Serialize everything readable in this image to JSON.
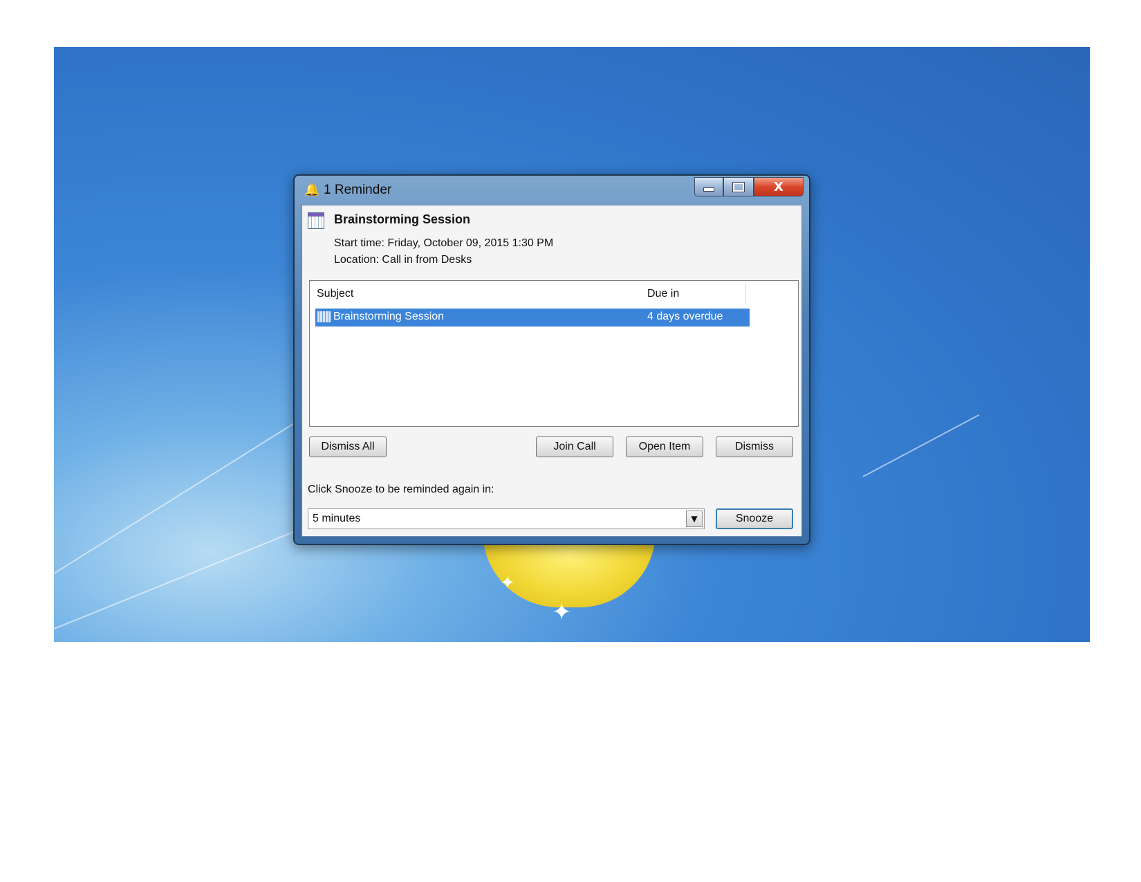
{
  "window": {
    "title": "1 Reminder",
    "caption_buttons": {
      "minimize_icon": "minimize-icon",
      "maximize_icon": "maximize-icon",
      "close_glyph": "X"
    }
  },
  "reminder": {
    "subject": "Brainstorming Session",
    "start_time": "Start time: Friday, October 09, 2015 1:30 PM",
    "location": "Location: Call in from Desks"
  },
  "list": {
    "columns": {
      "subject": "Subject",
      "due_in": "Due in"
    },
    "rows": [
      {
        "subject": "Brainstorming Session",
        "due_in": "4 days overdue",
        "selected": true
      }
    ]
  },
  "buttons": {
    "dismiss_all": "Dismiss All",
    "join_call": "Join Call",
    "open_item": "Open Item",
    "dismiss": "Dismiss",
    "snooze": "Snooze"
  },
  "snooze": {
    "prompt": "Click Snooze to be reminded again in:",
    "selected": "5 minutes"
  },
  "colors": {
    "selection": "#3b84d9",
    "desktop": "#2f74c8",
    "close_button": "#d9472b"
  }
}
